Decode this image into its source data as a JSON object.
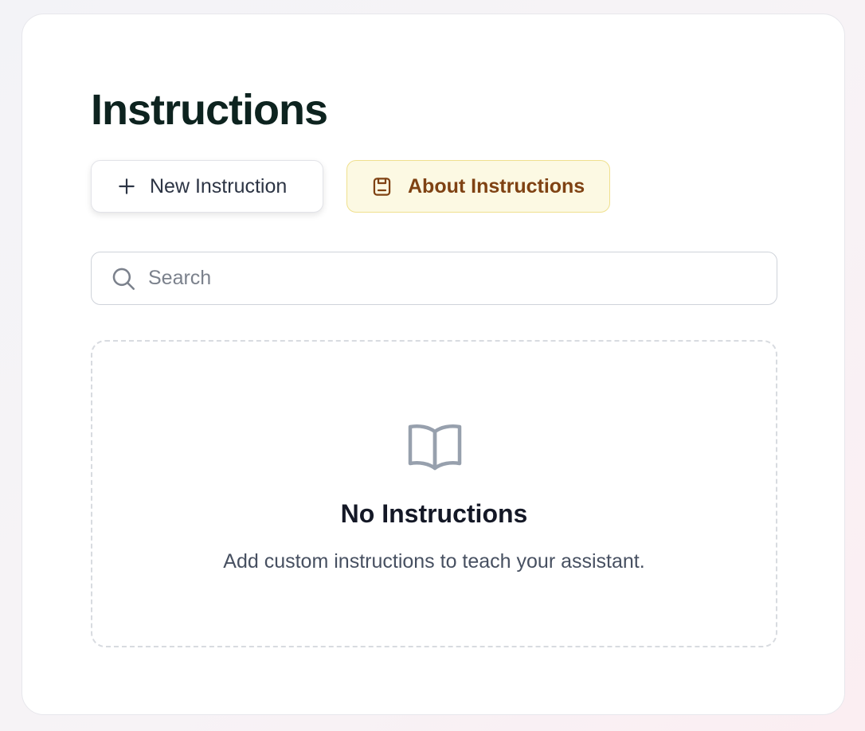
{
  "page": {
    "title": "Instructions"
  },
  "actions": {
    "new_label": "New Instruction",
    "new_icon": "plus-icon",
    "about_label": "About Instructions",
    "about_icon": "save-icon"
  },
  "search": {
    "placeholder": "Search",
    "value": "",
    "icon": "search-icon"
  },
  "empty_state": {
    "icon": "book-open-icon",
    "title": "No Instructions",
    "description": "Add custom instructions to teach your assistant."
  },
  "colors": {
    "title": "#0d231f",
    "about_bg": "#fcf9e3",
    "about_border": "#efe08e",
    "about_text": "#7f4213",
    "muted_icon": "#97a0ad"
  }
}
